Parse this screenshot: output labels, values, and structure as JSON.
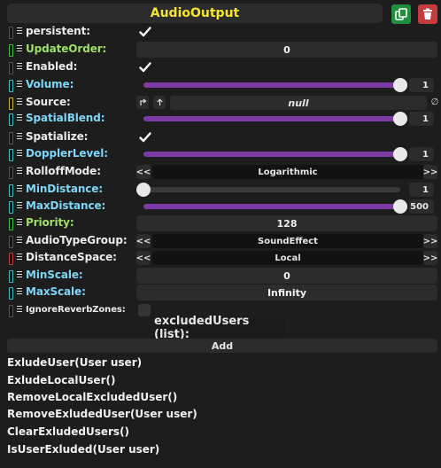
{
  "header": {
    "title": "AudioOutput",
    "duplicate_icon": "duplicate-icon",
    "delete_icon": "trash-icon",
    "colors": {
      "title": "#f5e430",
      "duplicate": "#1e8f3a",
      "delete": "#c63b3b"
    }
  },
  "fields": {
    "persistent": {
      "label": "persistent:",
      "checked": true
    },
    "update_order": {
      "label": "UpdateOrder:",
      "value": "0"
    },
    "enabled": {
      "label": "Enabled:",
      "checked": true
    },
    "volume": {
      "label": "Volume:",
      "value": "1",
      "fraction": 1.0
    },
    "source": {
      "label": "Source:",
      "value": "null",
      "clear_glyph": "∅"
    },
    "spatial_blend": {
      "label": "SpatialBlend:",
      "value": "1",
      "fraction": 1.0
    },
    "spatialize": {
      "label": "Spatialize:",
      "checked": true
    },
    "doppler_level": {
      "label": "DopplerLevel:",
      "value": "1",
      "fraction": 1.0
    },
    "rolloff_mode": {
      "label": "RolloffMode:",
      "value": "Logarithmic",
      "prev": "<<",
      "next": ">>"
    },
    "min_distance": {
      "label": "MinDistance:",
      "value": "1",
      "fraction": 0.0
    },
    "max_distance": {
      "label": "MaxDistance:",
      "value": "500",
      "fraction": 1.0
    },
    "priority": {
      "label": "Priority:",
      "value": "128"
    },
    "audio_type_group": {
      "label": "AudioTypeGroup:",
      "value": "SoundEffect",
      "prev": "<<",
      "next": ">>"
    },
    "distance_space": {
      "label": "DistanceSpace:",
      "value": "Local",
      "prev": "<<",
      "next": ">>"
    },
    "min_scale": {
      "label": "MinScale:",
      "value": "0"
    },
    "max_scale": {
      "label": "MaxScale:",
      "value": "Infinity"
    },
    "ignore_reverb_zones": {
      "label": "IgnoreReverbZones:",
      "checked": false
    }
  },
  "excluded_users": {
    "title": "excludedUsers (list):",
    "add_label": "Add"
  },
  "methods": [
    "ExludeUser(User user)",
    "ExludeLocalUser()",
    "RemoveLocalExcludedUser()",
    "RemoveExludedUser(User user)",
    "ClearExludedUsers()",
    "IsUserExluded(User user)"
  ]
}
